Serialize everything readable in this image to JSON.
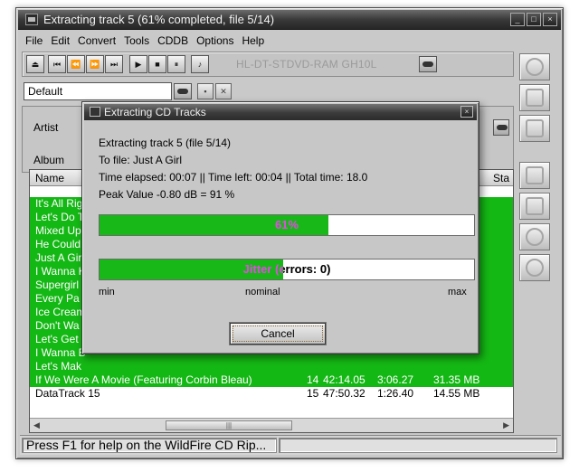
{
  "main_window": {
    "title": "Extracting track 5 (61% completed, file 5/14)",
    "title_buttons": [
      "_",
      "□",
      "×"
    ]
  },
  "menu": [
    "File",
    "Edit",
    "Convert",
    "Tools",
    "CDDB",
    "Options",
    "Help"
  ],
  "toolbar": {
    "drive": "HL-DT-STDVD-RAM GH10L"
  },
  "preset": {
    "value": "Default"
  },
  "info": {
    "artist_label": "Artist",
    "album_label": "Album"
  },
  "tracklist": {
    "headers": {
      "name": "Name",
      "status": "Sta"
    },
    "rows": [
      {
        "name": "It's All Rig",
        "selected": true
      },
      {
        "name": "Let's Do T",
        "selected": true
      },
      {
        "name": "Mixed Up",
        "selected": true
      },
      {
        "name": "He Could",
        "selected": true
      },
      {
        "name": "Just A Gir",
        "selected": true
      },
      {
        "name": "I Wanna K",
        "selected": true
      },
      {
        "name": "Supergirl",
        "selected": true
      },
      {
        "name": "Every Pa",
        "selected": true
      },
      {
        "name": "Ice Cream",
        "selected": true
      },
      {
        "name": "Don't Wa",
        "selected": true
      },
      {
        "name": "Let's Get",
        "selected": true
      },
      {
        "name": "I Wanna B",
        "selected": true
      },
      {
        "name": "Let's Mak",
        "selected": true
      },
      {
        "name": "If We Were A Movie (Featuring Corbin Bleau)",
        "num": "14",
        "start": "42:14.05",
        "length": "3:06.27",
        "size": "31.35 MB",
        "selected": true
      },
      {
        "name": "DataTrack 15",
        "num": "15",
        "start": "47:50.32",
        "length": "1:26.40",
        "size": "14.55 MB",
        "selected": false
      }
    ]
  },
  "statusbar": {
    "help_text": "Press F1 for help on the WildFire CD Rip..."
  },
  "dialog": {
    "title": "Extracting CD Tracks",
    "line_track": "Extracting track 5  (file 5/14)",
    "line_file": "To file: Just A Girl",
    "line_time": "Time elapsed: 00:07  ||  Time left: 00:04  ||  Total time: 18.0",
    "line_peak": "Peak Value -0.80 dB = 91 %",
    "progress": {
      "label": "61%",
      "fraction": 0.61
    },
    "jitter": {
      "label": "Jitter (errors: 0)",
      "fraction": 0.49
    },
    "scale": {
      "min": "min",
      "nominal": "nominal",
      "max": "max"
    },
    "cancel_label": "Cancel"
  },
  "colors": {
    "progress_fill": "#17b817",
    "selection": "#14b814",
    "titlebar": "#3a3a3a"
  }
}
